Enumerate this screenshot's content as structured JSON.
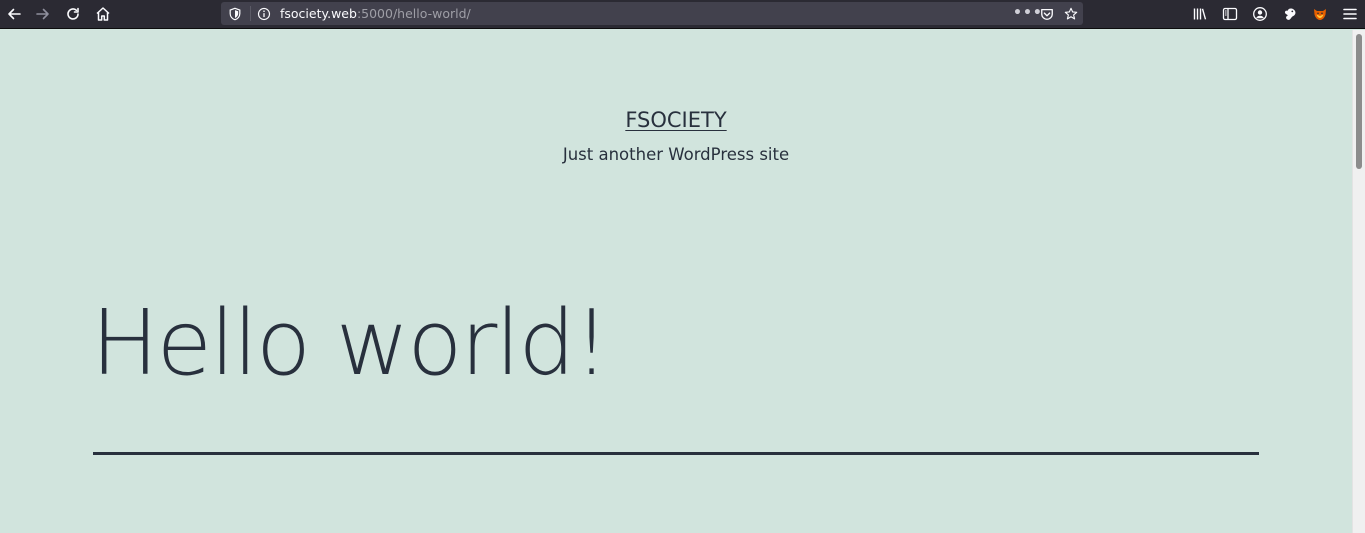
{
  "browser": {
    "url_host": "fsociety.web",
    "url_path": ":5000/hello-world/",
    "page_actions_label": "•••",
    "icons": {
      "back": "arrow-left-icon",
      "forward": "arrow-right-icon",
      "reload": "reload-icon",
      "home": "home-icon",
      "tracking": "shield-icon",
      "info": "info-icon",
      "pocket": "pocket-icon",
      "bookmark": "star-icon",
      "library": "library-icon",
      "sidebar": "sidebar-icon",
      "account": "account-icon",
      "extension1": "paw-icon",
      "extension2": "fox-icon",
      "menu": "hamburger-menu-icon"
    },
    "colors": {
      "toolbar": "#2b2a33",
      "urlbar": "#42414d"
    }
  },
  "site": {
    "title": "FSOCIETY",
    "tagline": "Just another WordPress site"
  },
  "post": {
    "title": "Hello world!"
  },
  "colors": {
    "page_background": "#d1e4dd",
    "text": "#28303d"
  }
}
